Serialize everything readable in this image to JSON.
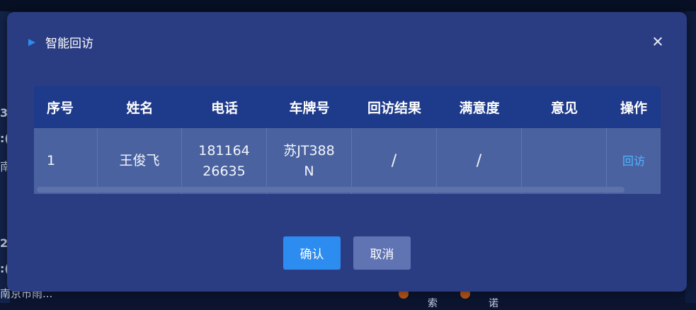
{
  "background": {
    "left_fragments": [
      "3",
      ":(",
      "南",
      "2",
      ":(",
      "南京市雨..."
    ],
    "bottom_chars": [
      "索",
      "诺"
    ]
  },
  "modal": {
    "title": "智能回访",
    "close_icon": "close-icon"
  },
  "table": {
    "columns": [
      "序号",
      "姓名",
      "电话",
      "车牌号",
      "回访结果",
      "满意度",
      "意见",
      "操作"
    ],
    "rows": [
      {
        "index": "1",
        "name": "王俊飞",
        "phone_line1": "181164",
        "phone_line2": "26635",
        "plate_line1": "苏JT388",
        "plate_line2": "N",
        "result": "/",
        "satisfaction": "/",
        "opinion": "",
        "action": "回访"
      }
    ]
  },
  "buttons": {
    "confirm": "确认",
    "cancel": "取消"
  },
  "colors": {
    "modal_bg": "#2b3d82",
    "header_bg": "#1e3a8a",
    "row_bg": "#4a63a0",
    "primary": "#2d8cf0",
    "link": "#4fb6ff"
  }
}
